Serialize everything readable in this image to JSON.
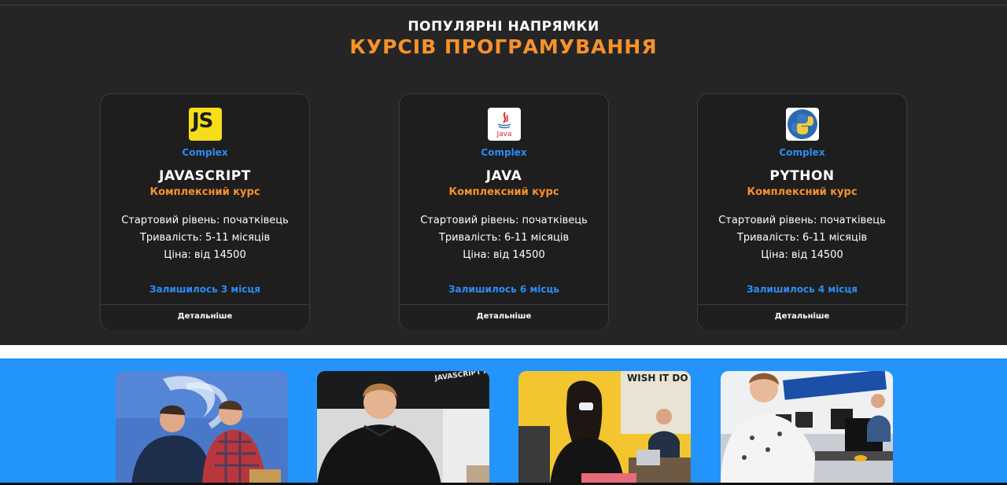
{
  "section": {
    "subtitle": "ПОПУЛЯРНІ НАПРЯМКИ",
    "title": "КУРСІВ ПРОГРАМУВАННЯ"
  },
  "colors": {
    "background": "#252525",
    "accent_orange": "#f7922a",
    "accent_blue": "#2b8cf5",
    "band_blue": "#2394fb"
  },
  "courses": [
    {
      "icon": "javascript-logo-icon",
      "logo_text": "JS",
      "tag": "Complex",
      "name": "JAVASCRIPT",
      "kind": "Комплексний курс",
      "level": "Стартовий рівень: початківець",
      "duration": "Тривалість: 5-11 місяців",
      "price": "Ціна: від 14500",
      "seats": "Залишилось 3 місця",
      "details": "Детальніше"
    },
    {
      "icon": "java-logo-icon",
      "logo_text": "Java",
      "tag": "Complex",
      "name": "JAVA",
      "kind": "Комплексний курс",
      "level": "Стартовий рівень: початківець",
      "duration": "Тривалість: 6-11 місяців",
      "price": "Ціна: від 14500",
      "seats": "Залишилось 6 місць",
      "details": "Детальніше"
    },
    {
      "icon": "python-logo-icon",
      "tag": "Complex",
      "name": "PYTHON",
      "kind": "Комплексний курс",
      "level": "Стартовий рівень: початківець",
      "duration": "Тривалість: 6-11 місяців",
      "price": "Ціна: від 14500",
      "seats": "Залишилось 4 місця",
      "details": "Детальніше"
    }
  ],
  "photos": [
    {
      "name": "photo-mentors-at-laptop",
      "wall_text": ""
    },
    {
      "name": "photo-student-at-desk",
      "wall_text": "JAVASCRIPT PYTHON JAVA QA"
    },
    {
      "name": "photo-students-yellow-wall",
      "wall_text": "WISH IT DO IT"
    },
    {
      "name": "photo-classroom-laptops",
      "wall_text": ""
    }
  ]
}
